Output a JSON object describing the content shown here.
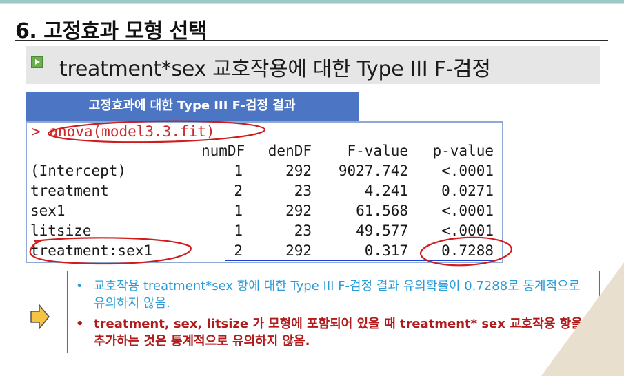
{
  "title": "6. 고정효과 모형 선택",
  "subtitle": "treatment*sex 교호작용에 대한 Type III F-검정",
  "result_header": "고정효과에 대한 Type III F-검정 결과",
  "console": {
    "prompt_symbol": ">",
    "command": "anova(model3.3.fit)",
    "columns": [
      "numDF",
      "denDF",
      "F-value",
      "p-value"
    ],
    "rows": [
      {
        "label": "(Intercept)",
        "numDF": "1",
        "denDF": "292",
        "F": "9027.742",
        "p": "<.0001"
      },
      {
        "label": "treatment",
        "numDF": "2",
        "denDF": "23",
        "F": "4.241",
        "p": "0.0271"
      },
      {
        "label": "sex1",
        "numDF": "1",
        "denDF": "292",
        "F": "61.568",
        "p": "<.0001"
      },
      {
        "label": "litsize",
        "numDF": "1",
        "denDF": "23",
        "F": "49.577",
        "p": "<.0001"
      },
      {
        "label": "treatment:sex1",
        "numDF": "2",
        "denDF": "292",
        "F": "0.317",
        "p": "0.7288"
      }
    ]
  },
  "notes": [
    {
      "bullet": "•",
      "text": "교호작용 treatment*sex 항에 대한 Type III F-검정 결과 유의확률이 0.7288로 통계적으로  유의하지 않음."
    },
    {
      "bullet": "•",
      "text": "treatment, sex, litsize 가 모형에 포함되어 있을 때 treatment* sex 교호작용 항을 추가하는 것은 통계적으로 유의하지 않음."
    }
  ],
  "colors": {
    "header_blue": "#4c76c4",
    "annotation_red": "#d01c1c",
    "note_blue": "#2b9cd8",
    "note_red": "#b11b1b",
    "bullet_green": "#6ab04c"
  },
  "icons": {
    "subtitle_bullet": "play-square-icon",
    "callout_arrow": "right-arrow-icon"
  }
}
